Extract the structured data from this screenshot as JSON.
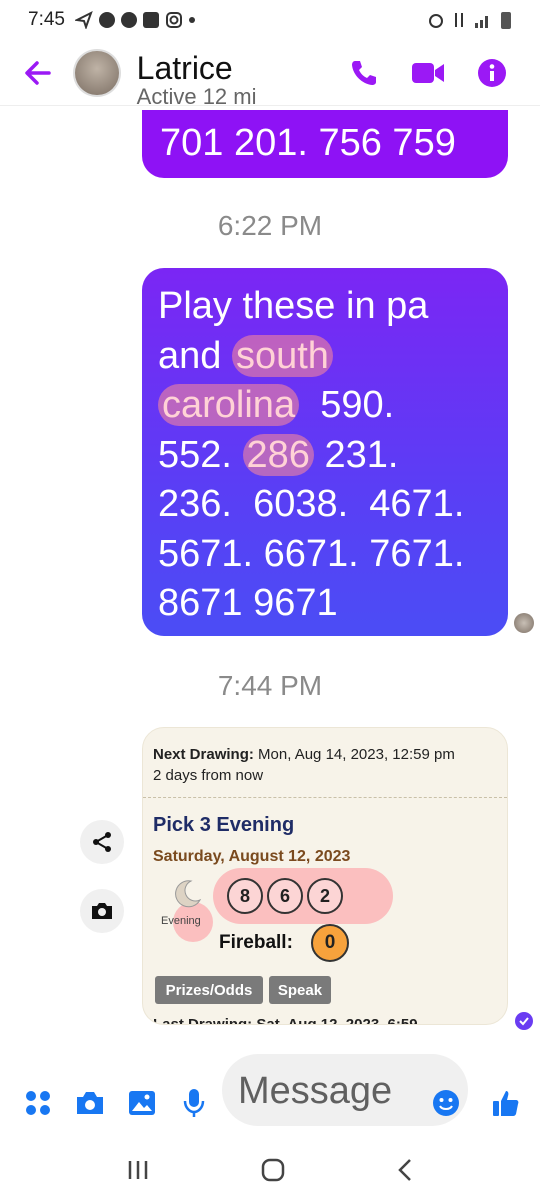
{
  "status_bar": {
    "time": "7:45"
  },
  "header": {
    "contact_name": "Latrice",
    "contact_status": "Active 12 mi",
    "back_icon": "arrow-left-icon",
    "actions": [
      "phone-icon",
      "video-icon",
      "info-icon"
    ]
  },
  "colors": {
    "accent": "#9b19f5",
    "bubble_top": "#7b26f4",
    "bubble_bottom": "#4b4df5",
    "highlight": "#ff8c96"
  },
  "messages": {
    "top_bubble_text": "701 201.  756 759",
    "time_1": "6:22 PM",
    "main_bubble": {
      "line1": "Play these in pa",
      "line2_a": "and ",
      "line2_hl": "south",
      "line3_hl": "carolina",
      "line3_b": "  590.",
      "line4_a": "552. ",
      "line4_hl": "286",
      "line4_b": " 231.",
      "line5": "236.  6038.  4671.",
      "line6": "5671. 6671. 7671.",
      "line7": "8671 9671"
    },
    "time_2": "7:44 PM"
  },
  "lottery_card": {
    "next_label": "Next Drawing:",
    "next_value": " Mon, Aug 14, 2023, 12:59 pm",
    "next_relative": "2 days from now",
    "game": "Pick 3 Evening",
    "date": "Saturday, August 12, 2023",
    "evening_label": "Evening",
    "balls": [
      "8",
      "6",
      "2"
    ],
    "fireball_label": "Fireball:",
    "fireball_value": "0",
    "prizes_button": "Prizes/Odds",
    "speak_button": "Speak",
    "last_drawing_partial": "Last Drawing:  Sat, Aug 12, 2023, 6:59"
  },
  "side_actions": [
    "share-icon",
    "camera-icon"
  ],
  "composer": {
    "placeholder": "Message",
    "icons": [
      "menu-dots-icon",
      "camera-icon",
      "gallery-icon",
      "microphone-icon",
      "emoji-icon",
      "thumbs-up-icon"
    ]
  },
  "nav": [
    "recents-icon",
    "home-icon",
    "back-icon"
  ]
}
